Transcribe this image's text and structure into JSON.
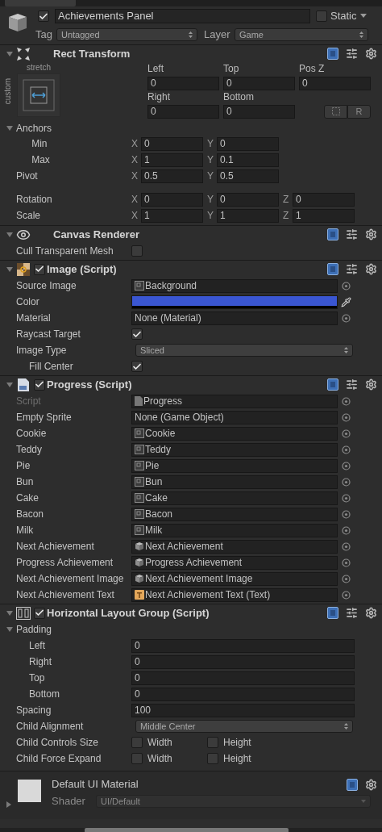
{
  "game_object": {
    "active": true,
    "name": "Achievements Panel",
    "static": {
      "label": "Static",
      "checked": false
    },
    "tag": {
      "label": "Tag",
      "value": "Untagged"
    },
    "layer": {
      "label": "Layer",
      "value": "Game"
    }
  },
  "rect_transform": {
    "title": "Rect Transform",
    "expanded": true,
    "anchor_preset": {
      "horizontal": "stretch",
      "vertical": "custom"
    },
    "position_fields": [
      {
        "label": "Left",
        "value": "0"
      },
      {
        "label": "Top",
        "value": "0"
      },
      {
        "label": "Pos Z",
        "value": "0"
      },
      {
        "label": "Right",
        "value": "0"
      },
      {
        "label": "Bottom",
        "value": "0"
      }
    ],
    "reset_button": "R",
    "anchors": {
      "label": "Anchors",
      "expanded": true,
      "children": [
        {
          "label": "Min",
          "components": [
            {
              "axis": "X",
              "value": "0"
            },
            {
              "axis": "Y",
              "value": "0"
            }
          ]
        },
        {
          "label": "Max",
          "components": [
            {
              "axis": "X",
              "value": "1"
            },
            {
              "axis": "Y",
              "value": "0.1"
            }
          ]
        }
      ]
    },
    "pivot": {
      "label": "Pivot",
      "components": [
        {
          "axis": "X",
          "value": "0.5"
        },
        {
          "axis": "Y",
          "value": "0.5"
        }
      ]
    },
    "transform_rows": [
      {
        "label": "Rotation",
        "components": [
          {
            "axis": "X",
            "value": "0"
          },
          {
            "axis": "Y",
            "value": "0"
          },
          {
            "axis": "Z",
            "value": "0"
          }
        ]
      },
      {
        "label": "Scale",
        "components": [
          {
            "axis": "X",
            "value": "1"
          },
          {
            "axis": "Y",
            "value": "1"
          },
          {
            "axis": "Z",
            "value": "1"
          }
        ]
      }
    ]
  },
  "components": [
    {
      "kind": "canvas_renderer",
      "title": "Canvas Renderer",
      "expanded": true,
      "properties": [
        {
          "kind": "toggle",
          "label": "Cull Transparent Mesh",
          "checked": false
        }
      ]
    },
    {
      "kind": "image",
      "title": "Image (Script)",
      "enabled": true,
      "expanded": true,
      "properties": [
        {
          "kind": "object",
          "label": "Source Image",
          "value": "Background",
          "asset": {
            "kind": "sprite"
          }
        },
        {
          "kind": "color",
          "label": "Color",
          "color": "#3a56d2"
        },
        {
          "kind": "object",
          "label": "Material",
          "value": "None (Material)"
        },
        {
          "kind": "toggle",
          "label": "Raycast Target",
          "checked": true
        },
        {
          "kind": "dropdown",
          "label": "Image Type",
          "value": "Sliced",
          "children": [
            {
              "kind": "toggle",
              "label": "Fill Center",
              "checked": true
            }
          ]
        }
      ]
    },
    {
      "kind": "script",
      "title": "Progress (Script)",
      "enabled": true,
      "expanded": true,
      "properties": [
        {
          "kind": "object",
          "label": "Script",
          "value": "Progress",
          "asset": {
            "kind": "script"
          },
          "disabled": true
        },
        {
          "kind": "object",
          "label": "Empty Sprite",
          "value": "None (Game Object)",
          "disabled": false
        },
        {
          "kind": "object",
          "label": "Cookie",
          "value": "Cookie",
          "asset": {
            "kind": "sprite"
          },
          "disabled": false
        },
        {
          "kind": "object",
          "label": "Teddy",
          "value": "Teddy",
          "asset": {
            "kind": "sprite"
          },
          "disabled": false
        },
        {
          "kind": "object",
          "label": "Pie",
          "value": "Pie",
          "asset": {
            "kind": "sprite"
          },
          "disabled": false
        },
        {
          "kind": "object",
          "label": "Bun",
          "value": "Bun",
          "asset": {
            "kind": "sprite"
          },
          "disabled": false
        },
        {
          "kind": "object",
          "label": "Cake",
          "value": "Cake",
          "asset": {
            "kind": "sprite"
          },
          "disabled": false
        },
        {
          "kind": "object",
          "label": "Bacon",
          "value": "Bacon",
          "asset": {
            "kind": "sprite"
          },
          "disabled": false
        },
        {
          "kind": "object",
          "label": "Milk",
          "value": "Milk",
          "asset": {
            "kind": "sprite"
          },
          "disabled": false
        },
        {
          "kind": "object",
          "label": "Next Achievement",
          "value": "Next Achievement",
          "asset": {
            "kind": "game_object"
          },
          "disabled": false
        },
        {
          "kind": "object",
          "label": "Progress Achievement",
          "value": "Progress Achievement",
          "asset": {
            "kind": "game_object"
          },
          "disabled": false
        },
        {
          "kind": "object",
          "label": "Next Achievement Image",
          "value": "Next Achievement Image",
          "asset": {
            "kind": "game_object"
          },
          "disabled": false
        },
        {
          "kind": "object",
          "label": "Next Achievement Text",
          "value": "Next Achievement Text (Text)",
          "asset": {
            "kind": "text"
          },
          "disabled": false
        }
      ]
    },
    {
      "kind": "layout",
      "title": "Horizontal Layout Group (Script)",
      "enabled": true,
      "expanded": true,
      "properties": [
        {
          "kind": "group",
          "label": "Padding",
          "expanded": true,
          "children": [
            {
              "kind": "field",
              "label": "Left",
              "value": "0"
            },
            {
              "kind": "field",
              "label": "Right",
              "value": "0"
            },
            {
              "kind": "field",
              "label": "Top",
              "value": "0"
            },
            {
              "kind": "field",
              "label": "Bottom",
              "value": "0"
            }
          ]
        },
        {
          "kind": "field",
          "label": "Spacing",
          "value": "100"
        },
        {
          "kind": "dropdown",
          "label": "Child Alignment",
          "value": "Middle Center"
        },
        {
          "kind": "toggles",
          "label": "Child Controls Size",
          "options": [
            {
              "label": "Width",
              "checked": false
            },
            {
              "label": "Height",
              "checked": false
            }
          ]
        },
        {
          "kind": "toggles",
          "label": "Child Force Expand",
          "options": [
            {
              "label": "Width",
              "checked": false
            },
            {
              "label": "Height",
              "checked": false
            }
          ]
        }
      ]
    }
  ],
  "material": {
    "name": "Default UI Material",
    "expanded": false,
    "shader_label": "Shader",
    "shader": "UI/Default"
  }
}
